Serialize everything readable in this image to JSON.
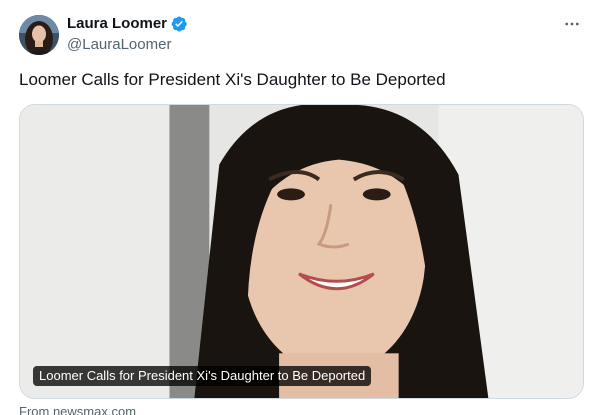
{
  "author": {
    "display_name": "Laura Loomer",
    "handle": "@LauraLoomer",
    "verified_icon": "verified-badge-icon",
    "verified_color": "#1d9bf0"
  },
  "menu": {
    "more_icon": "more-horizontal-icon",
    "more_label": "···"
  },
  "tweet": {
    "text": "Loomer Calls for President Xi's Daughter to Be Deported"
  },
  "card": {
    "title": "Loomer Calls for President Xi's Daughter to Be Deported",
    "source": "From newsmax.com",
    "image_subject": "photo of a smiling young woman with long dark hair"
  },
  "colors": {
    "text_primary": "#0f1419",
    "text_secondary": "#536471",
    "border": "#cfd9de"
  }
}
